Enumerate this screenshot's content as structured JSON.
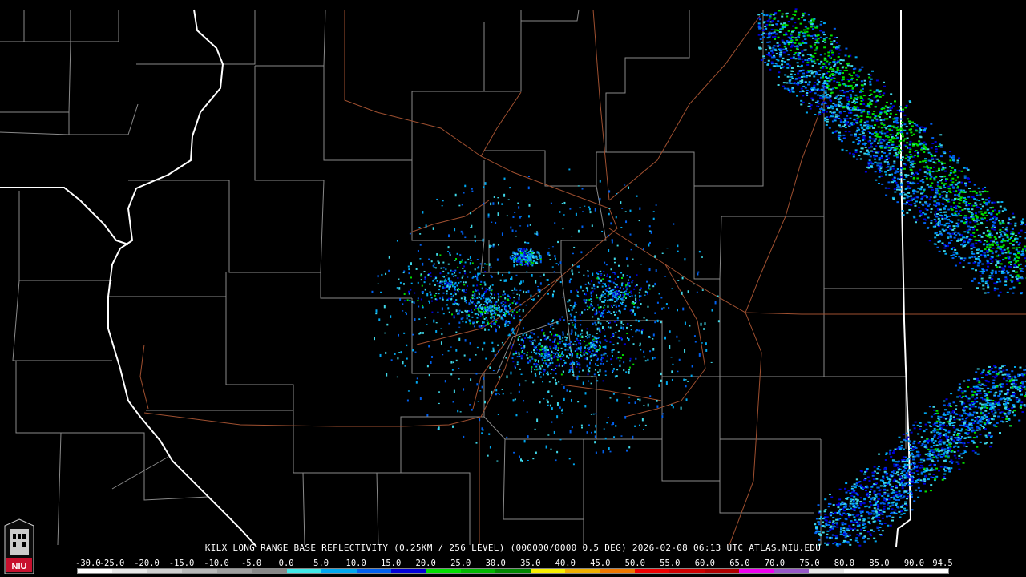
{
  "product_caption": "KILX LONG RANGE BASE REFLECTIVITY (0.25KM / 256 LEVEL) (000000/0000 0.5 DEG) 2026-02-08 06:13 UTC  ATLAS.NIU.EDU",
  "logo_text": "NIU",
  "scale": {
    "labels": [
      "-30.0",
      "-25.0",
      "-20.0",
      "-15.0",
      "-10.0",
      "-5.0",
      "0.0",
      "5.0",
      "10.0",
      "15.0",
      "20.0",
      "25.0",
      "30.0",
      "35.0",
      "40.0",
      "45.0",
      "50.0",
      "55.0",
      "60.0",
      "65.0",
      "70.0",
      "75.0",
      "80.0",
      "85.0",
      "90.0",
      "94.5"
    ],
    "colors": [
      "#ffffff",
      "#e8e8e8",
      "#d0d0d0",
      "#b8b8b8",
      "#a0a0a0",
      "#888888",
      "#40e8e8",
      "#00a8f0",
      "#0060f0",
      "#0000d8",
      "#00e000",
      "#00b800",
      "#008800",
      "#f8f000",
      "#f0b000",
      "#f07800",
      "#f00000",
      "#d00000",
      "#b00000",
      "#f000f0",
      "#9858c8",
      "#e8e8e8",
      "#ffffff",
      "#ffffff",
      "#ffffff"
    ]
  },
  "colors": {
    "background": "#000000",
    "county_lines": "#8a8a8a",
    "state_lines": "#ffffff",
    "roads": "#a05030"
  }
}
